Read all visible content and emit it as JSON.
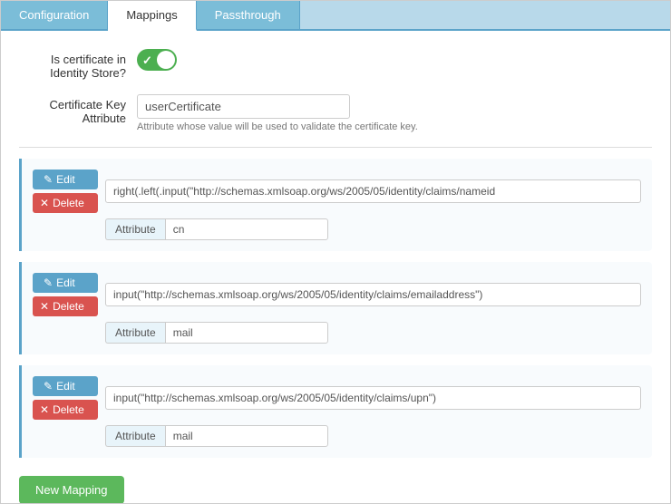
{
  "tabs": [
    {
      "id": "configuration",
      "label": "Configuration",
      "active": false
    },
    {
      "id": "mappings",
      "label": "Mappings",
      "active": true
    },
    {
      "id": "passthrough",
      "label": "Passthrough",
      "active": false
    }
  ],
  "form": {
    "certificate_in_store_label": "Is certificate in\nIdentity Store?",
    "certificate_key_label": "Certificate Key\nAttribute",
    "certificate_key_value": "userCertificate",
    "certificate_key_hint": "Attribute whose value will be used to validate the certificate key."
  },
  "mappings": [
    {
      "expression": "right(.left(.input(\"http://schemas.xmlsoap.org/ws/2005/05/identity/claims/nameid",
      "attribute_label": "Attribute",
      "attribute_value": "cn",
      "edit_label": "✎ Edit",
      "delete_label": "✕ Delete"
    },
    {
      "expression": "input(\"http://schemas.xmlsoap.org/ws/2005/05/identity/claims/emailaddress\")",
      "attribute_label": "Attribute",
      "attribute_value": "mail",
      "edit_label": "✎ Edit",
      "delete_label": "✕ Delete"
    },
    {
      "expression": "input(\"http://schemas.xmlsoap.org/ws/2005/05/identity/claims/upn\")",
      "attribute_label": "Attribute",
      "attribute_value": "mail",
      "edit_label": "✎ Edit",
      "delete_label": "✕ Delete"
    }
  ],
  "new_mapping_label": "New Mapping",
  "colors": {
    "tab_active_bg": "#ffffff",
    "tab_inactive_bg": "#7bbdd8",
    "toggle_on": "#4caf50",
    "edit_btn": "#5ba3c9",
    "delete_btn": "#d9534f",
    "new_mapping_btn": "#5cb85c"
  }
}
